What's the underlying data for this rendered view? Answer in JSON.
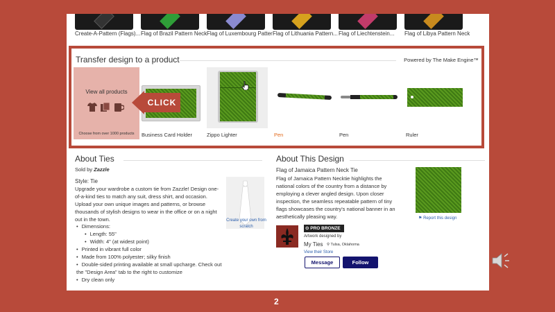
{
  "top_strip": {
    "items": [
      {
        "label": "Create-A-Pattern (Flags)...",
        "tie_color": "#1a1a1a"
      },
      {
        "label": "Flag of Brazil Pattern Neck...",
        "tie_color": "#2f9e38"
      },
      {
        "label": "Flag of Luxembourg Patter...",
        "tie_color": "#8a8ad0"
      },
      {
        "label": "Flag of Lithuania Pattern...",
        "tie_color": "#d6a21e"
      },
      {
        "label": "Flag of Liechtenstein...",
        "tie_color": "#c23b6a"
      },
      {
        "label": "Flag of Libya Pattern Neck...",
        "tie_color": "#c88a1e"
      }
    ]
  },
  "transfer": {
    "title": "Transfer design to a product",
    "powered_by": "Powered by The Make Engine™",
    "view_all": {
      "title": "View all products",
      "subtitle": "Choose from over 1000 products",
      "icons": [
        "tshirt-icon",
        "cards-icon",
        "mug-icon"
      ]
    },
    "click_label": "CLICK",
    "products": [
      {
        "label": "Business Card Holder"
      },
      {
        "label": "Zippo Lighter"
      },
      {
        "label": "Pen"
      },
      {
        "label": "Pen"
      },
      {
        "label": "Ruler"
      }
    ]
  },
  "about_ties": {
    "title": "About Ties",
    "sold_by_prefix": "Sold by",
    "seller": "Zazzle",
    "style": "Style: Tie",
    "description": "Upgrade your wardrobe a custom tie from Zazzle! Design one-of-a-kind ties to match any suit, dress shirt, and occasion. Upload your own unique images and patterns, or browse thousands of stylish designs to wear in the office or on a night out in the town.",
    "create_link": "Create your own from scratch",
    "bullets": [
      {
        "text": "Dimensions:",
        "sub": false
      },
      {
        "text": "Length: 55\"",
        "sub": true
      },
      {
        "text": "Width: 4\" (at widest point)",
        "sub": true
      },
      {
        "text": "Printed in vibrant full color",
        "sub": false
      },
      {
        "text": "Made from 100% polyester; silky finish",
        "sub": false
      },
      {
        "text": "Double-sided printing available at small upcharge. Check out the \"Design Area\" tab to the right to customize",
        "sub": false
      },
      {
        "text": "Dry clean only",
        "sub": false
      }
    ]
  },
  "about_design": {
    "title": "About This Design",
    "design_name": "Flag of Jamaica Pattern Neck Tie",
    "description": "Flag of Jamaica Pattern Necktie highlights the national colors of the country from a distance by employing a clever angled design. Upon closer inspection, the seamless repeatable pattern of tiny flags showcases the country's national banner in an aesthetically pleasing way.",
    "report_link": "Report this design",
    "badge": "PRO BRONZE",
    "designed_by_label": "Artwork designed by",
    "store_name": "My Ties",
    "location": "Tulsa, Oklahoma",
    "view_store": "View their Store",
    "message_button": "Message",
    "follow_button": "Follow"
  },
  "slide_number": "2",
  "colors": {
    "background": "#b84a3a",
    "tie_green": "#4a8a18",
    "follow_navy": "#13136e",
    "link_blue": "#2a5dab",
    "orange_label": "#e26a1c"
  }
}
